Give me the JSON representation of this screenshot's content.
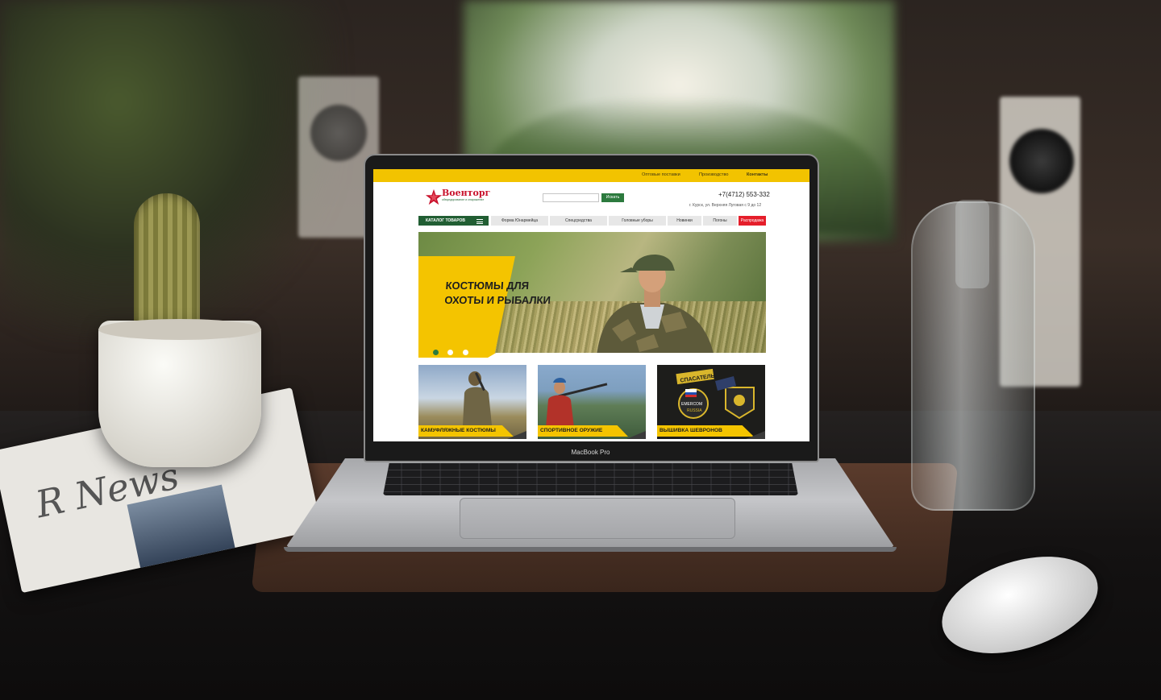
{
  "laptop": {
    "model_label": "MacBook Pro"
  },
  "newspaper": {
    "masthead": "R News"
  },
  "site": {
    "topbar": {
      "links": [
        "Оптовые поставки",
        "Производство",
        "Контакты"
      ]
    },
    "logo": {
      "name": "Военторг",
      "tagline": "обмундирование и снаряжение"
    },
    "search": {
      "placeholder": "",
      "button_label": "Искать"
    },
    "contacts": {
      "phone": "+7(4712) 553-332",
      "address": "г. Курск, ул. Верхняя Луговая с 9 до 12"
    },
    "nav": {
      "catalog_label": "КАТАЛОГ ТОВАРОВ",
      "items": [
        "Форма Юнармейца",
        "Спецсредства",
        "Головные уборы",
        "Новинки",
        "Погоны",
        "Распродажа"
      ]
    },
    "hero": {
      "title_line1": "КОСТЮМЫ ДЛЯ",
      "title_line2": "ОХОТЫ И РЫБАЛКИ",
      "slides": 3,
      "active_slide": 1
    },
    "cards": [
      {
        "label": "КАМУФЛЯЖНЫЕ КОСТЮМЫ"
      },
      {
        "label": "СПОРТИВНОЕ ОРУЖИЕ"
      },
      {
        "label": "ВЫШИВКА ШЕВРОНОВ"
      }
    ],
    "patches": {
      "word1": "СПАСАТЕЛЬ",
      "word2": "EMERCOM",
      "word3": "RUSSIA"
    },
    "colors": {
      "accent": "#f4c400",
      "brand_green": "#215e33",
      "sale_red": "#e51e2b",
      "logo_red": "#c9122c"
    }
  }
}
